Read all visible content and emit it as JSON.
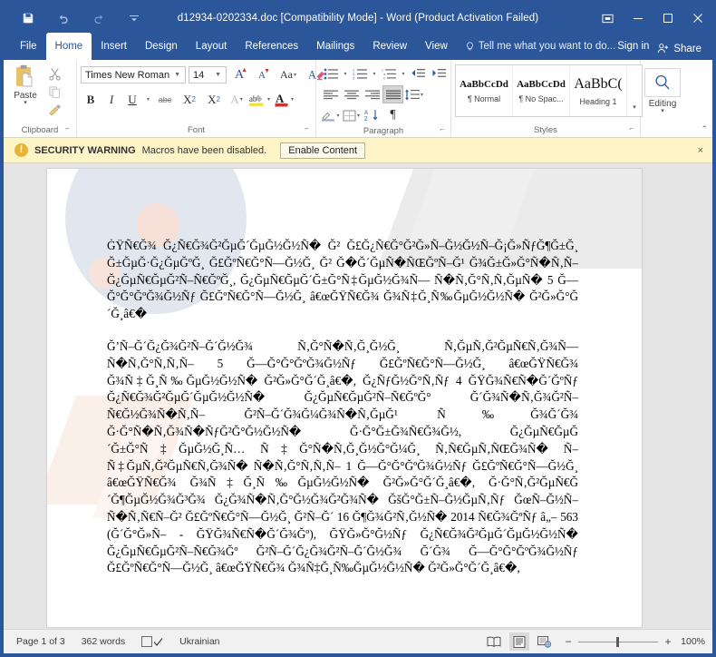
{
  "window": {
    "title": "d12934-0202334.doc [Compatibility Mode] - Word (Product Activation Failed)",
    "quick_access": [
      {
        "name": "save-icon",
        "label": "Save"
      },
      {
        "name": "undo-icon",
        "label": "Undo"
      },
      {
        "name": "redo-icon",
        "label": "Redo"
      },
      {
        "name": "customize-qat-icon",
        "label": "Customize Quick Access Toolbar"
      }
    ],
    "controls": [
      {
        "name": "ribbon-display-options-icon",
        "label": "Ribbon Display Options"
      },
      {
        "name": "minimize-icon",
        "label": "Minimize"
      },
      {
        "name": "maximize-icon",
        "label": "Maximize"
      },
      {
        "name": "close-icon",
        "label": "Close"
      }
    ]
  },
  "tabs": [
    {
      "label": "File",
      "active": false
    },
    {
      "label": "Home",
      "active": true
    },
    {
      "label": "Insert",
      "active": false
    },
    {
      "label": "Design",
      "active": false
    },
    {
      "label": "Layout",
      "active": false
    },
    {
      "label": "References",
      "active": false
    },
    {
      "label": "Mailings",
      "active": false
    },
    {
      "label": "Review",
      "active": false
    },
    {
      "label": "View",
      "active": false
    }
  ],
  "tellme": {
    "placeholder": "Tell me what you want to do...",
    "text": "Tell me what you want to do..."
  },
  "signin": {
    "label": "Sign in"
  },
  "share": {
    "label": "Share"
  },
  "ribbon": {
    "clipboard": {
      "group_label": "Clipboard",
      "paste_label": "Paste",
      "cut_label": "Cut",
      "copy_label": "Copy",
      "format_painter_label": "Format Painter"
    },
    "font": {
      "group_label": "Font",
      "font_name": "Times New Roman",
      "font_size": "14",
      "grow_font_label": "A",
      "shrink_font_label": "A",
      "change_case_label": "Aa",
      "clear_formatting_label": "A",
      "bold_label": "B",
      "italic_label": "I",
      "underline_label": "U",
      "strikethrough_label": "abc",
      "subscript_label": "X",
      "subscript_sub": "2",
      "superscript_label": "X",
      "superscript_sup": "2",
      "text_effects_label": "A",
      "highlight_label": "ab",
      "font_color_label": "A"
    },
    "paragraph": {
      "group_label": "Paragraph",
      "bullets_label": "Bullets",
      "numbering_label": "Numbering",
      "multilevel_label": "Multilevel List",
      "decrease_indent_label": "Decrease Indent",
      "increase_indent_label": "Increase Indent",
      "align_left_label": "Align Left",
      "align_center_label": "Center",
      "align_right_label": "Align Right",
      "justify_label": "Justify",
      "line_spacing_label": "Line and Paragraph Spacing",
      "shading_label": "Shading",
      "borders_label": "Borders",
      "sort_label": "Sort",
      "show_marks_label": "¶"
    },
    "styles": {
      "group_label": "Styles",
      "items": [
        {
          "sample": "AaBbCcDd",
          "name": "¶ Normal"
        },
        {
          "sample": "AaBbCcDd",
          "name": "¶ No Spac..."
        },
        {
          "sample": "AaBbC(",
          "name": "Heading 1"
        }
      ],
      "more_label": "More"
    },
    "editing": {
      "group_label": "Editing",
      "label": "Editing"
    },
    "collapse_label": "Collapse the Ribbon"
  },
  "security_bar": {
    "icon_name": "warning-icon",
    "icon_glyph": "!",
    "title": "SECURITY WARNING",
    "message": "Macros have been disabled.",
    "button_label": "Enable Content",
    "close_label": "×"
  },
  "document": {
    "paragraphs": [
      "ĠŸÑ€Ğ¾  Ğ¿Ñ€Ğ¾Ğ²ĞµĞ´ĞµĞ½Ğ½Ñ�  Ğ²  Ğ£Ğ¿Ñ€Ğ°Ğ²Ğ»Ñ–Ğ½Ğ½Ñ–Ğ¡Ğ»ÑƒĞ¶Ğ±Ğ¸       Ğ±ĞµĞ·Ğ¿ĞµĞºĞ¸       Ğ£ĞºÑ€Ğ°Ñ—Ğ½Ğ¸       Ğ² Ğ�Ğ´ĞµÑ�ÑŒĞºÑ–Ğ¹   Ğ¾Ğ±Ğ»Ğ°Ñ�Ñ‚Ñ–   Ğ¿ĞµÑ€ĞµĞ²Ñ–Ñ€ĞºĞ¸, Ğ¿ĞµÑ€ĞµĞ´Ğ±Ğ°Ñ‡ĞµĞ½Ğ¾Ñ—        Ñ�Ñ‚Ğ°Ñ‚Ñ‚ĞµÑ�       5      Ğ—Ğ°Ğ°ĞºĞ¾Ğ½Ñƒ Ğ£ĞºÑ€Ğ°Ñ—Ğ½Ğ¸ â€œĞŸÑ€Ğ¾ Ğ¾Ñ‡Ğ¸Ñ‰ĞµĞ½Ğ½Ñ� Ğ²Ğ»Ğ°Ğ´Ğ¸â€�",
      "Ğ’Ñ–Ğ´Ğ¿Ğ¾Ğ²Ñ–Ğ´Ğ½Ğ¾ Ñ‚Ğ°Ñ�Ñ‚Ğ¸Ğ½Ğ¸ Ñ‚ĞµÑ‚Ğ²ĞµÑ€Ñ‚Ğ¾Ñ— Ñ�Ñ‚Ğ°Ñ‚Ñ‚Ñ– 5 Ğ—Ğ°Ğ°ĞºĞ¾Ğ½Ñƒ Ğ£ĞºÑ€Ğ°Ñ—Ğ½Ğ¸ â€œĞŸÑ€Ğ¾ Ğ¾Ñ‡Ğ¸Ñ‰ĞµĞ½Ğ½Ñ�     Ğ²Ğ»Ğ°Ğ´Ğ¸â€�,     Ğ¿ÑƒĞ½Ğ°Ñ‚Ñƒ    4 ĞŸĞ¾Ñ€Ñ�Ğ´ĞºÑƒ Ğ¿Ñ€Ğ¾Ğ²ĞµĞ´ĞµĞ½Ğ½Ñ� Ğ¿ĞµÑ€ĞµĞ²Ñ–Ñ€ĞºĞ° Ğ´Ğ¾Ñ�Ñ‚Ğ¾Ğ²Ñ–Ñ€Ğ½Ğ¾Ñ�Ñ‚Ñ–    Ğ²Ñ–Ğ´Ğ¾Ğ¼Ğ¾Ñ�Ñ‚ĞµĞ¹ Ñ‰Ğ¾Ğ´Ğ¾  Ğ·Ğ°Ñ�Ñ‚Ğ¾Ñ�ÑƒĞ²Ğ°Ğ½Ğ½Ñ�  Ğ·Ğ°Ğ±Ğ¾Ñ€Ğ¾Ğ½, Ğ¿ĞµÑ€ĞµĞ´Ğ±Ğ°Ñ‡ĞµĞ½Ğ¸Ñ…          Ñ‡Ğ°Ñ�Ñ‚Ğ¸Ğ½Ğ°Ğ¼Ğ¸ Ñ‚Ñ€ĞµÑ‚ÑŒĞ¾Ñ� Ñ– Ñ‡ĞµÑ‚Ğ²ĞµÑ€Ñ‚Ğ¾Ñ� Ñ�Ñ‚Ğ°Ñ‚Ñ‚Ñ– 1 Ğ—Ğ°Ğ°ĞºĞ¾Ğ½Ñƒ Ğ£ĞºÑ€Ğ°Ñ—Ğ½Ğ¸ â€œĞŸÑ€Ğ¾ Ğ¾Ñ‡Ğ¸Ñ‰ĞµĞ½Ğ½Ñ� Ğ²Ğ»Ğ°Ğ´Ğ¸â€�,               Ğ·Ğ°Ñ‚Ğ²ĞµÑ€Ğ´Ğ¶ĞµĞ½Ğ¾Ğ³Ğ¾ Ğ¿Ğ¾Ñ�Ñ‚Ğ°Ğ½Ğ¾Ğ²Ğ¾Ñ�       ĞšĞ°Ğ±Ñ–Ğ½ĞµÑ‚Ñƒ    ĞœÑ–Ğ½Ñ–Ñ�Ñ‚Ñ€Ñ–Ğ² Ğ£ĞºÑ€Ğ°Ñ—Ğ½Ğ¸ Ğ²Ñ–Ğ´ 16 Ğ¶Ğ¾Ğ²Ñ‚Ğ½Ñ� 2014 Ñ€Ğ¾ĞºÑƒ â„– 563 (Ğ´Ğ°Ğ»Ñ– - ĞŸĞ¾Ñ€Ñ�Ğ´Ğ¾Ğº), ĞŸĞ»Ğ°Ğ½Ñƒ Ğ¿Ñ€Ğ¾Ğ²ĞµĞ´ĞµĞ½Ğ½Ñ� Ğ¿ĞµÑ€ĞµĞ²Ñ–Ñ€Ğ¾Ğº Ğ²Ñ–Ğ´Ğ¿Ğ¾Ğ²Ñ–Ğ´Ğ½Ğ¾ Ğ´Ğ¾ Ğ—Ğ°Ğ°ĞºĞ¾Ğ½Ñƒ Ğ£ĞºÑ€Ğ°Ñ—Ğ½Ğ¸ â€œĞŸÑ€Ğ¾ Ğ¾Ñ‡Ğ¸Ñ‰ĞµĞ½Ğ½Ñ�                 Ğ²Ğ»Ğ°Ğ´Ğ¸â€�,"
    ]
  },
  "status_bar": {
    "page": "Page 1 of 3",
    "words": "362 words",
    "proofing_name": "proofing-errors-icon",
    "language": "Ukrainian",
    "views": [
      {
        "name": "read-mode-icon",
        "label": "Read Mode",
        "selected": false
      },
      {
        "name": "print-layout-icon",
        "label": "Print Layout",
        "selected": true
      },
      {
        "name": "web-layout-icon",
        "label": "Web Layout",
        "selected": false
      }
    ],
    "zoom_out_label": "−",
    "zoom_in_label": "+",
    "zoom_value": "100%"
  },
  "colors": {
    "word_blue": "#2b579a",
    "ribbon_white": "#ffffff",
    "security_yellow": "#fdf4c8",
    "doc_grey": "#e4e4e4"
  }
}
